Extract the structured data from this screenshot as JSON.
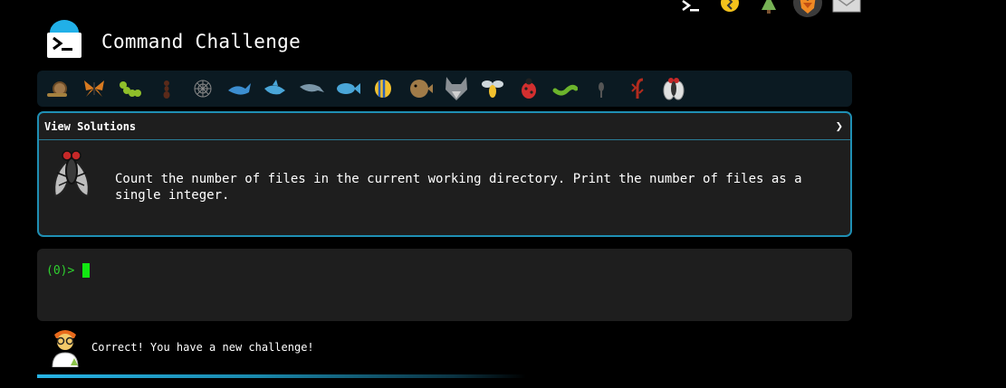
{
  "app": {
    "title": "Command Challenge"
  },
  "top_icons": [
    "terminal-icon",
    "lightbulb-icon",
    "tree-icon",
    "fox-badge-icon",
    "mail-icon"
  ],
  "challenge_bar": {
    "icons": [
      "snail-icon",
      "butterfly-icon",
      "caterpillar-icon",
      "ant-icon",
      "spider-web-icon",
      "whale-icon",
      "shark-icon",
      "dolphin-icon",
      "fish-icon",
      "tropical-fish-icon",
      "pufferfish-icon",
      "wolf-icon",
      "bee-icon",
      "ladybug-icon",
      "worm-icon",
      "mosquito-icon",
      "scorpion-icon",
      "fly-icon"
    ]
  },
  "challenge": {
    "view_solutions_label": "View Solutions",
    "chevron": "❯",
    "description": "Count the number of files in the current working directory. Print the number of files as a single integer.",
    "icon": "fly-icon"
  },
  "terminal": {
    "prompt": "(0)>"
  },
  "status": {
    "message": "Correct! You have a new challenge!"
  },
  "colors": {
    "accent": "#1f8fb4",
    "prompt": "#2fd12f",
    "cursor": "#12e812",
    "card_bg": "#1e1e1e",
    "bar_bg": "#0b1a22"
  }
}
